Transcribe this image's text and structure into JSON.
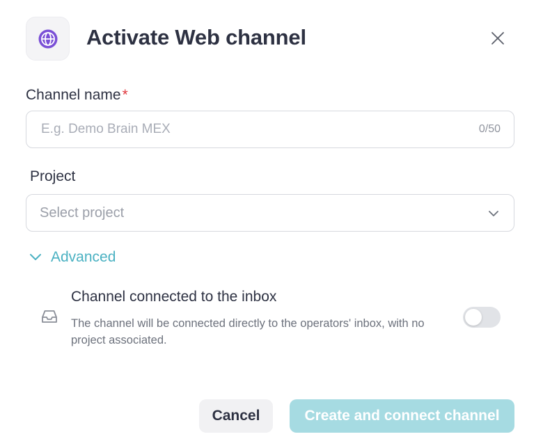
{
  "header": {
    "icon": "globe-icon",
    "title": "Activate Web channel",
    "close_icon": "close-icon"
  },
  "form": {
    "channel_name": {
      "label": "Channel name",
      "required_mark": "*",
      "placeholder": "E.g. Demo Brain MEX",
      "value": "",
      "counter": "0/50"
    },
    "project": {
      "label": "Project",
      "placeholder": "Select project",
      "chevron_icon": "chevron-down-icon"
    }
  },
  "advanced": {
    "label": "Advanced",
    "expanded": true,
    "option": {
      "icon": "inbox-icon",
      "title": "Channel connected to the inbox",
      "description": "The channel will be connected directly to the operators' inbox, with no project associated.",
      "enabled": false
    }
  },
  "footer": {
    "cancel_label": "Cancel",
    "create_label": "Create and connect channel"
  },
  "colors": {
    "accent": "#4ab1c2",
    "primary_disabled": "#a6dbe2",
    "globe_icon": "#7a4fd6",
    "required": "#e0383e"
  }
}
